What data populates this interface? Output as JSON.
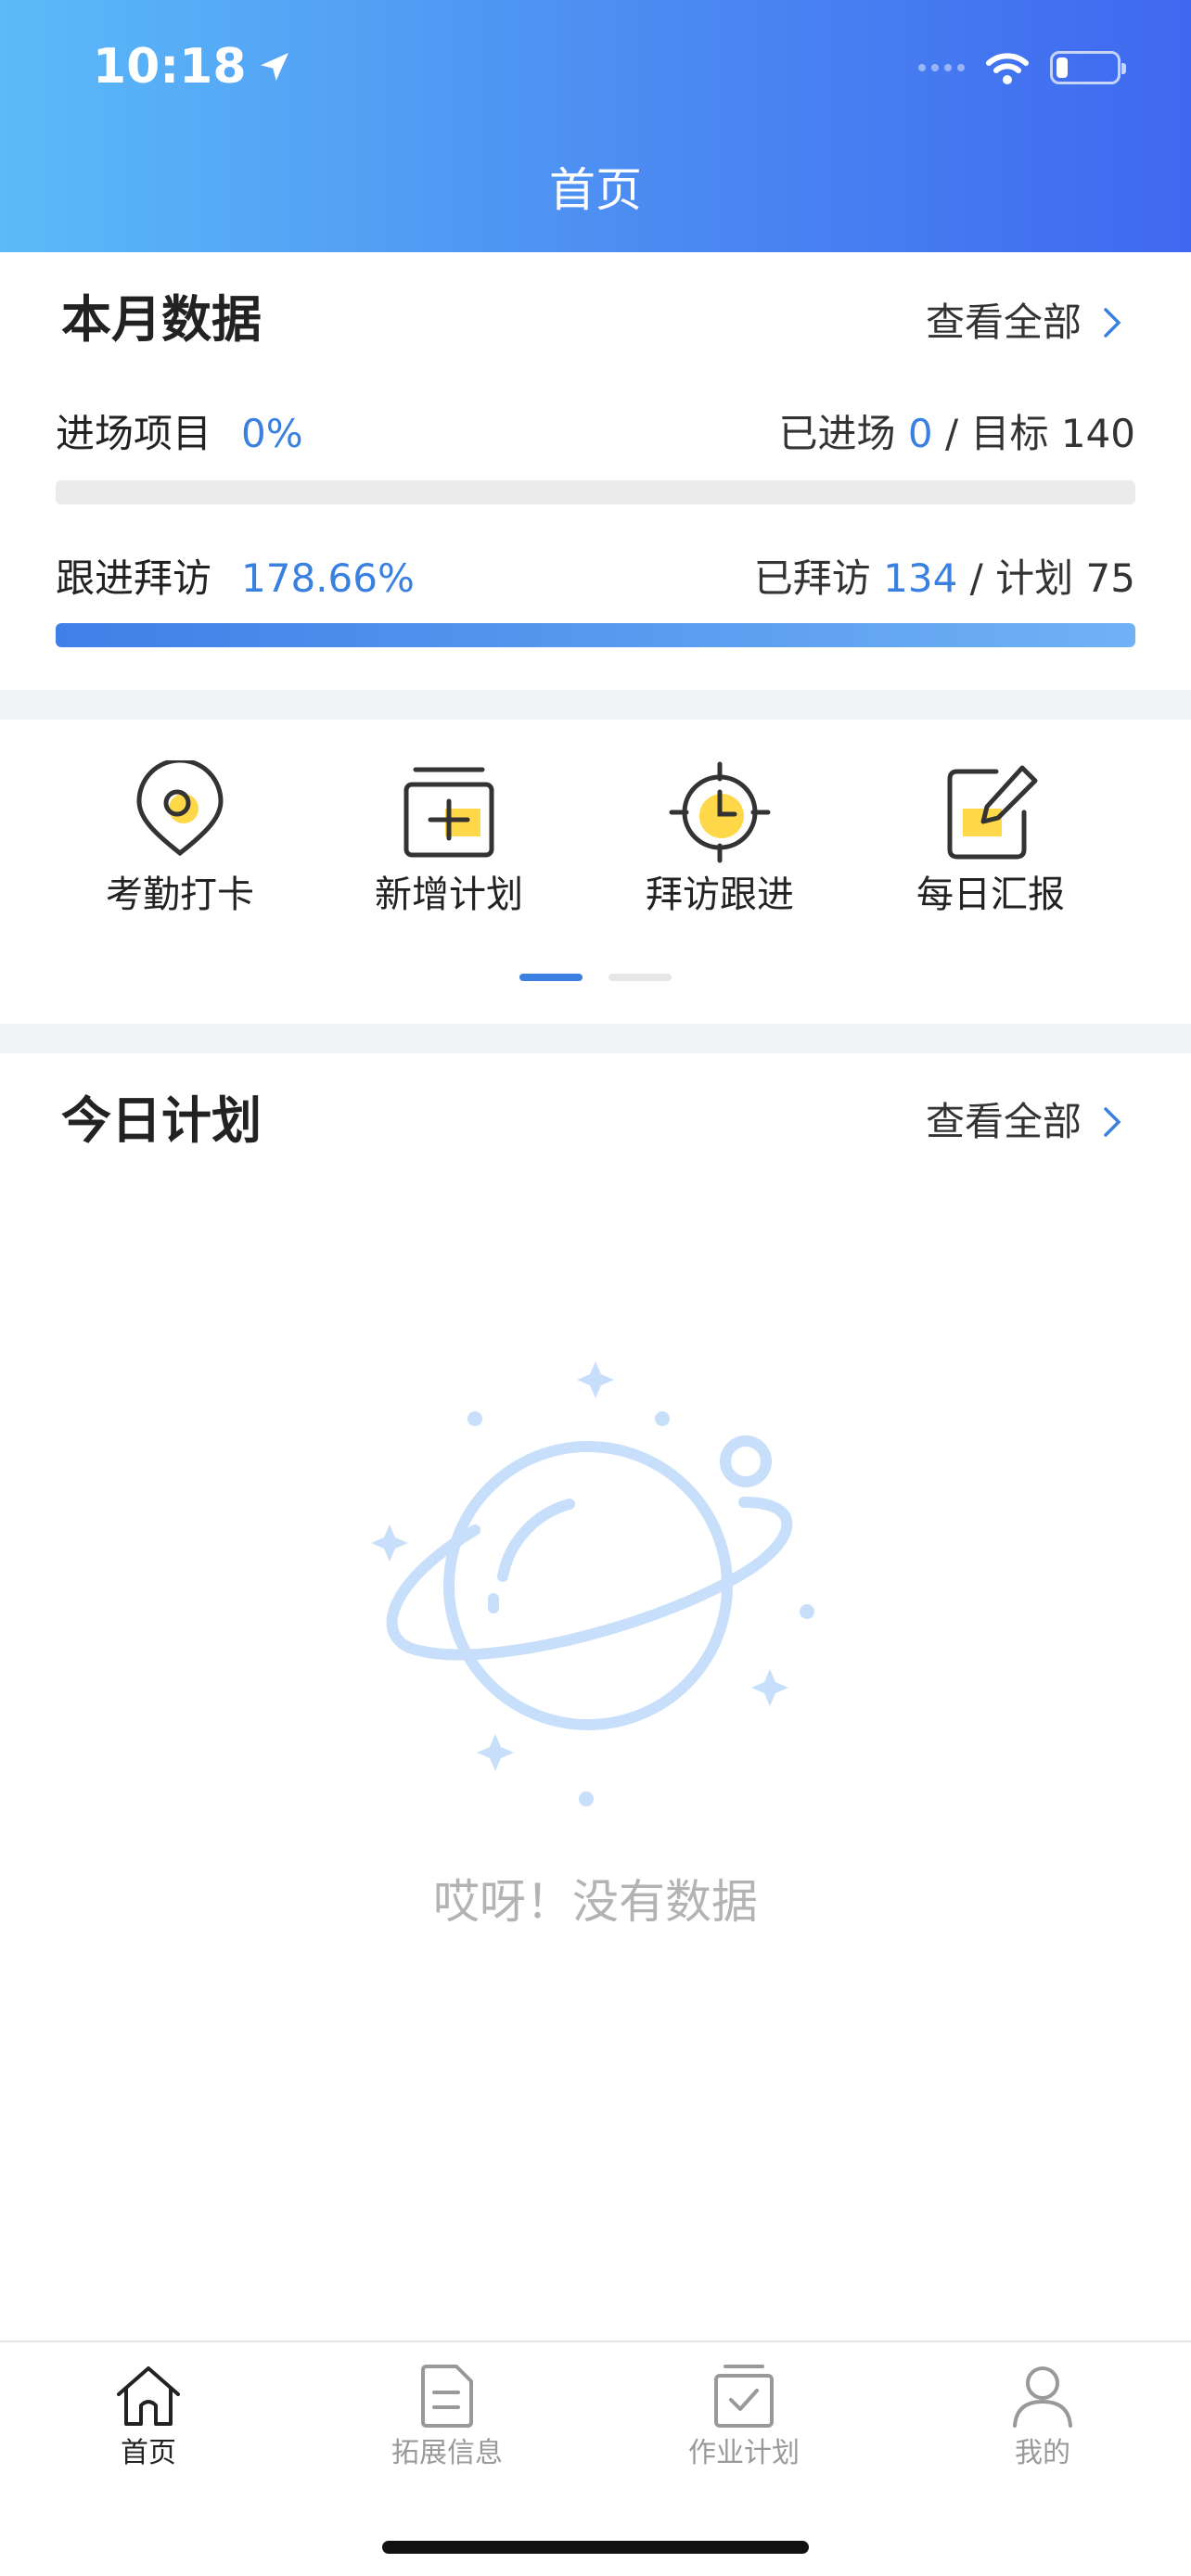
{
  "status_bar": {
    "time": "10:18"
  },
  "header": {
    "title": "首页"
  },
  "monthly": {
    "title": "本月数据",
    "view_all": "查看全部",
    "rows": [
      {
        "label": "进场项目",
        "percent": "0%",
        "done_label": "已进场",
        "done_value": "0",
        "separator": "/",
        "target_label": "目标",
        "target_value": "140",
        "progress": 0
      },
      {
        "label": "跟进拜访",
        "percent": "178.66%",
        "done_label": "已拜访",
        "done_value": "134",
        "separator": "/",
        "target_label": "计划",
        "target_value": "75",
        "progress": 1
      }
    ]
  },
  "actions": [
    {
      "label": "考勤打卡",
      "icon": "location-pin-icon"
    },
    {
      "label": "新增计划",
      "icon": "add-plan-icon"
    },
    {
      "label": "拜访跟进",
      "icon": "target-clock-icon"
    },
    {
      "label": "每日汇报",
      "icon": "edit-report-icon"
    }
  ],
  "pager": {
    "pages": 2,
    "current": 1
  },
  "today": {
    "title": "今日计划",
    "view_all": "查看全部",
    "empty_text": "哎呀！没有数据"
  },
  "tabbar": [
    {
      "label": "首页",
      "icon": "home-icon",
      "active": true
    },
    {
      "label": "拓展信息",
      "icon": "document-icon",
      "active": false
    },
    {
      "label": "作业计划",
      "icon": "calendar-check-icon",
      "active": false
    },
    {
      "label": "我的",
      "icon": "user-icon",
      "active": false
    }
  ],
  "colors": {
    "accent": "#3a80e0",
    "highlight": "#ffd84a",
    "header_start": "#5bbaf8",
    "header_end": "#3f68f0"
  }
}
